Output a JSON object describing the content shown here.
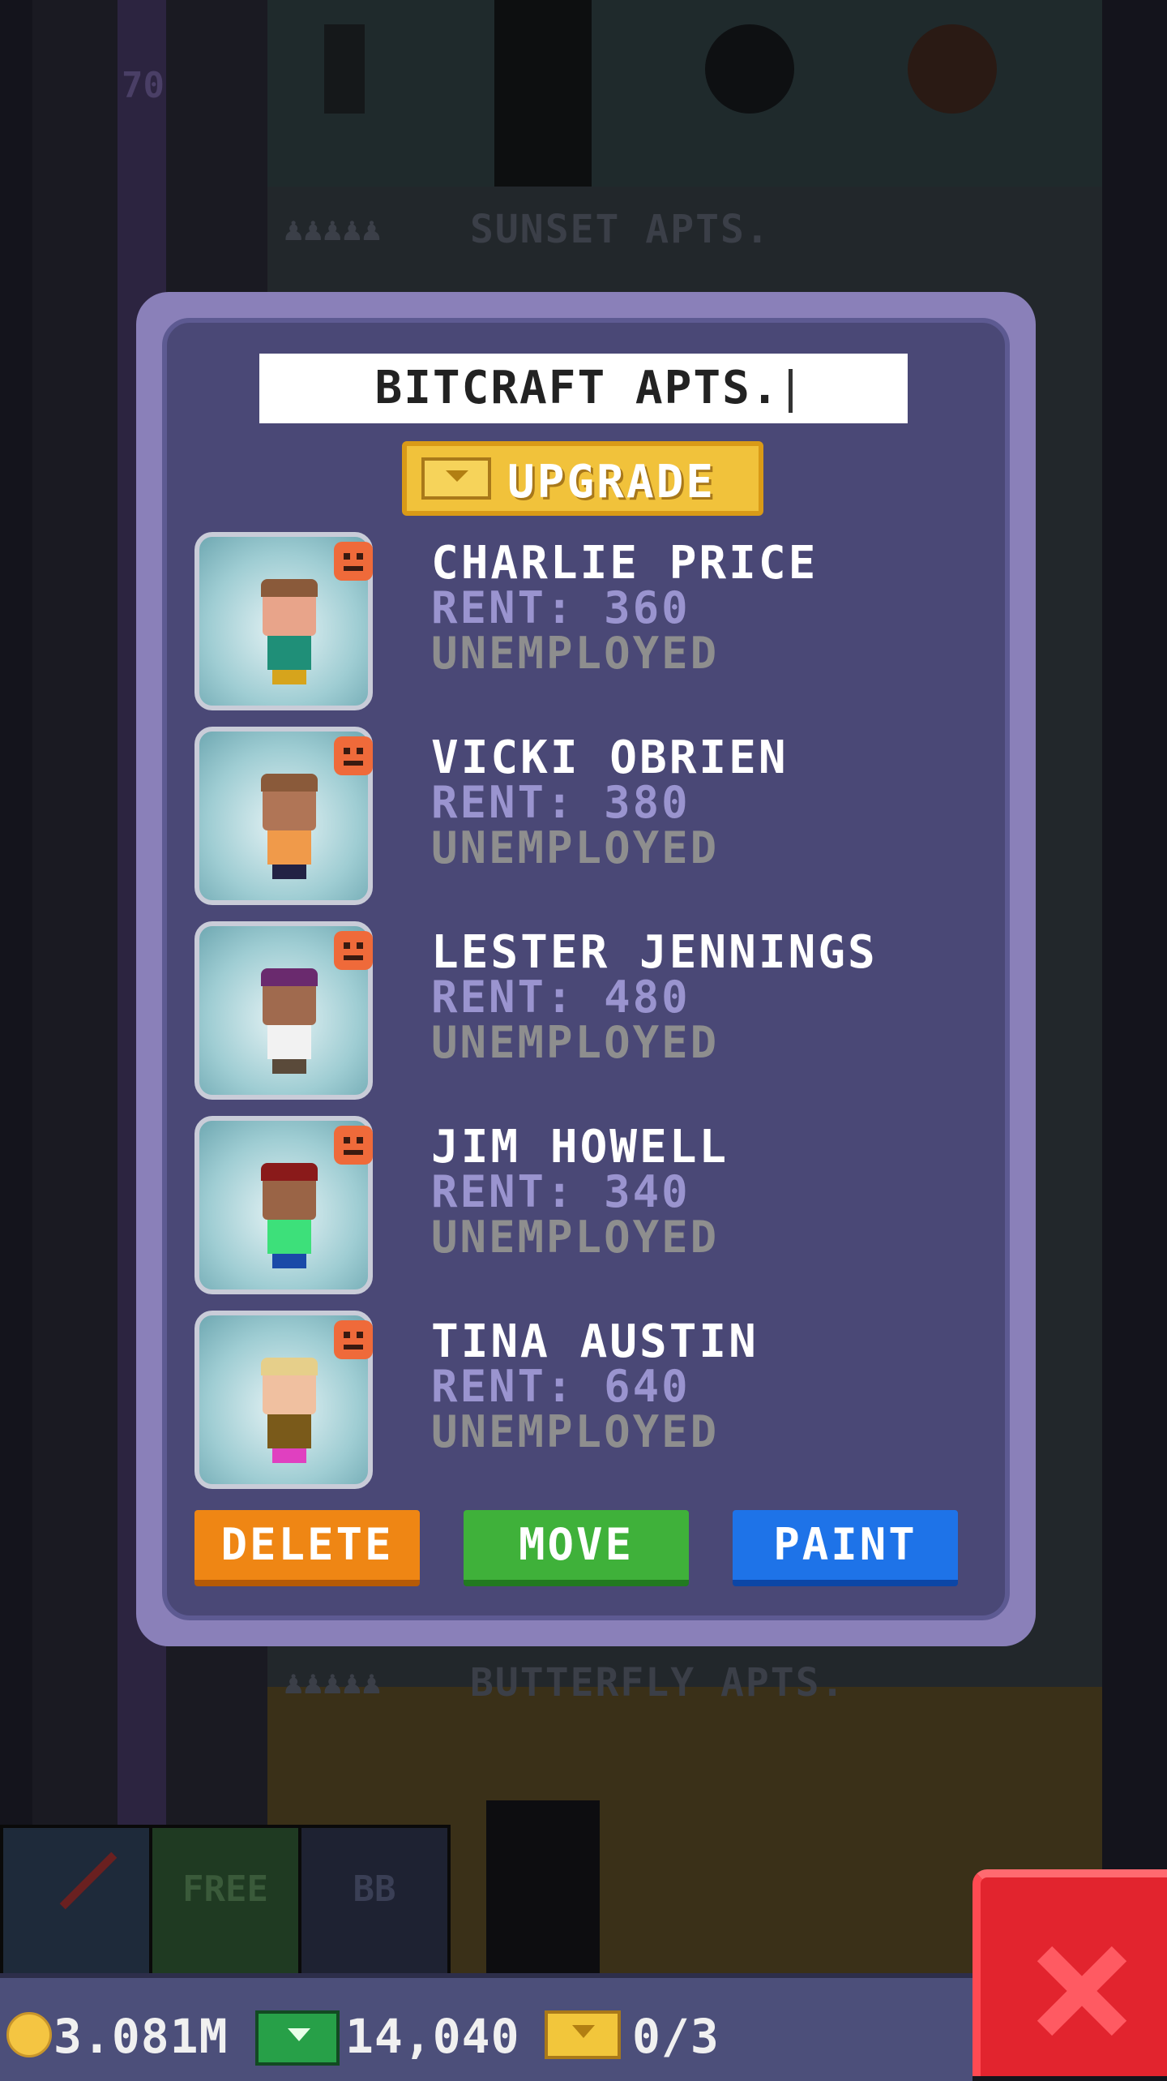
{
  "building_name": "BITCRAFT APTS.",
  "upgrade_label": "UPGRADE",
  "background": {
    "floor_top_label": "SUNSET APTS.",
    "floor_bottom_label": "BUTTERFLY APTS.",
    "floor_number": "70",
    "hud_free_label": "FREE",
    "hud_bb_label": "BB",
    "dots": "♟♟♟♟♟"
  },
  "residents": [
    {
      "name": "CHARLIE PRICE",
      "rent": "RENT: 360",
      "job": "UNEMPLOYED",
      "mood": "unhappy",
      "skin": "#e8a48a",
      "hair": "#8a5a3a",
      "shirt": "#1f8f78",
      "pants": "#d6a41c"
    },
    {
      "name": "VICKI OBRIEN",
      "rent": "RENT: 380",
      "job": "UNEMPLOYED",
      "mood": "unhappy",
      "skin": "#b07556",
      "hair": "#8a5a3a",
      "shirt": "#f09a4a",
      "pants": "#222244"
    },
    {
      "name": "LESTER JENNINGS",
      "rent": "RENT: 480",
      "job": "UNEMPLOYED",
      "mood": "unhappy",
      "skin": "#a06a4e",
      "hair": "#6a2a6e",
      "shirt": "#f2f2f2",
      "pants": "#5a4a3a"
    },
    {
      "name": "JIM HOWELL",
      "rent": "RENT: 340",
      "job": "UNEMPLOYED",
      "mood": "unhappy",
      "skin": "#9a6446",
      "hair": "#8a1a1a",
      "shirt": "#3de07a",
      "pants": "#1a4aa8"
    },
    {
      "name": "TINA AUSTIN",
      "rent": "RENT: 640",
      "job": "UNEMPLOYED",
      "mood": "unhappy",
      "skin": "#f0c0a0",
      "hair": "#e6cf8a",
      "shirt": "#7a5a1a",
      "pants": "#e040c0"
    }
  ],
  "actions": {
    "delete": "DELETE",
    "move": "MOVE",
    "paint": "PAINT"
  },
  "status": {
    "coins": "3.081M",
    "bux_cash": "14,040",
    "golden_tickets": "0/3"
  },
  "icons": {
    "coin": "coin-icon",
    "cash": "cash-icon",
    "bux": "bux-icon",
    "close": "close-icon",
    "mood": "sad-face-icon"
  },
  "colors": {
    "dialog_outer": "#8a80b9",
    "dialog_inner": "#4a4876",
    "delete": "#ef8614",
    "move": "#3fb13a",
    "paint": "#1e73e8",
    "upgrade": "#f1c23b",
    "close": "#e2242e"
  }
}
